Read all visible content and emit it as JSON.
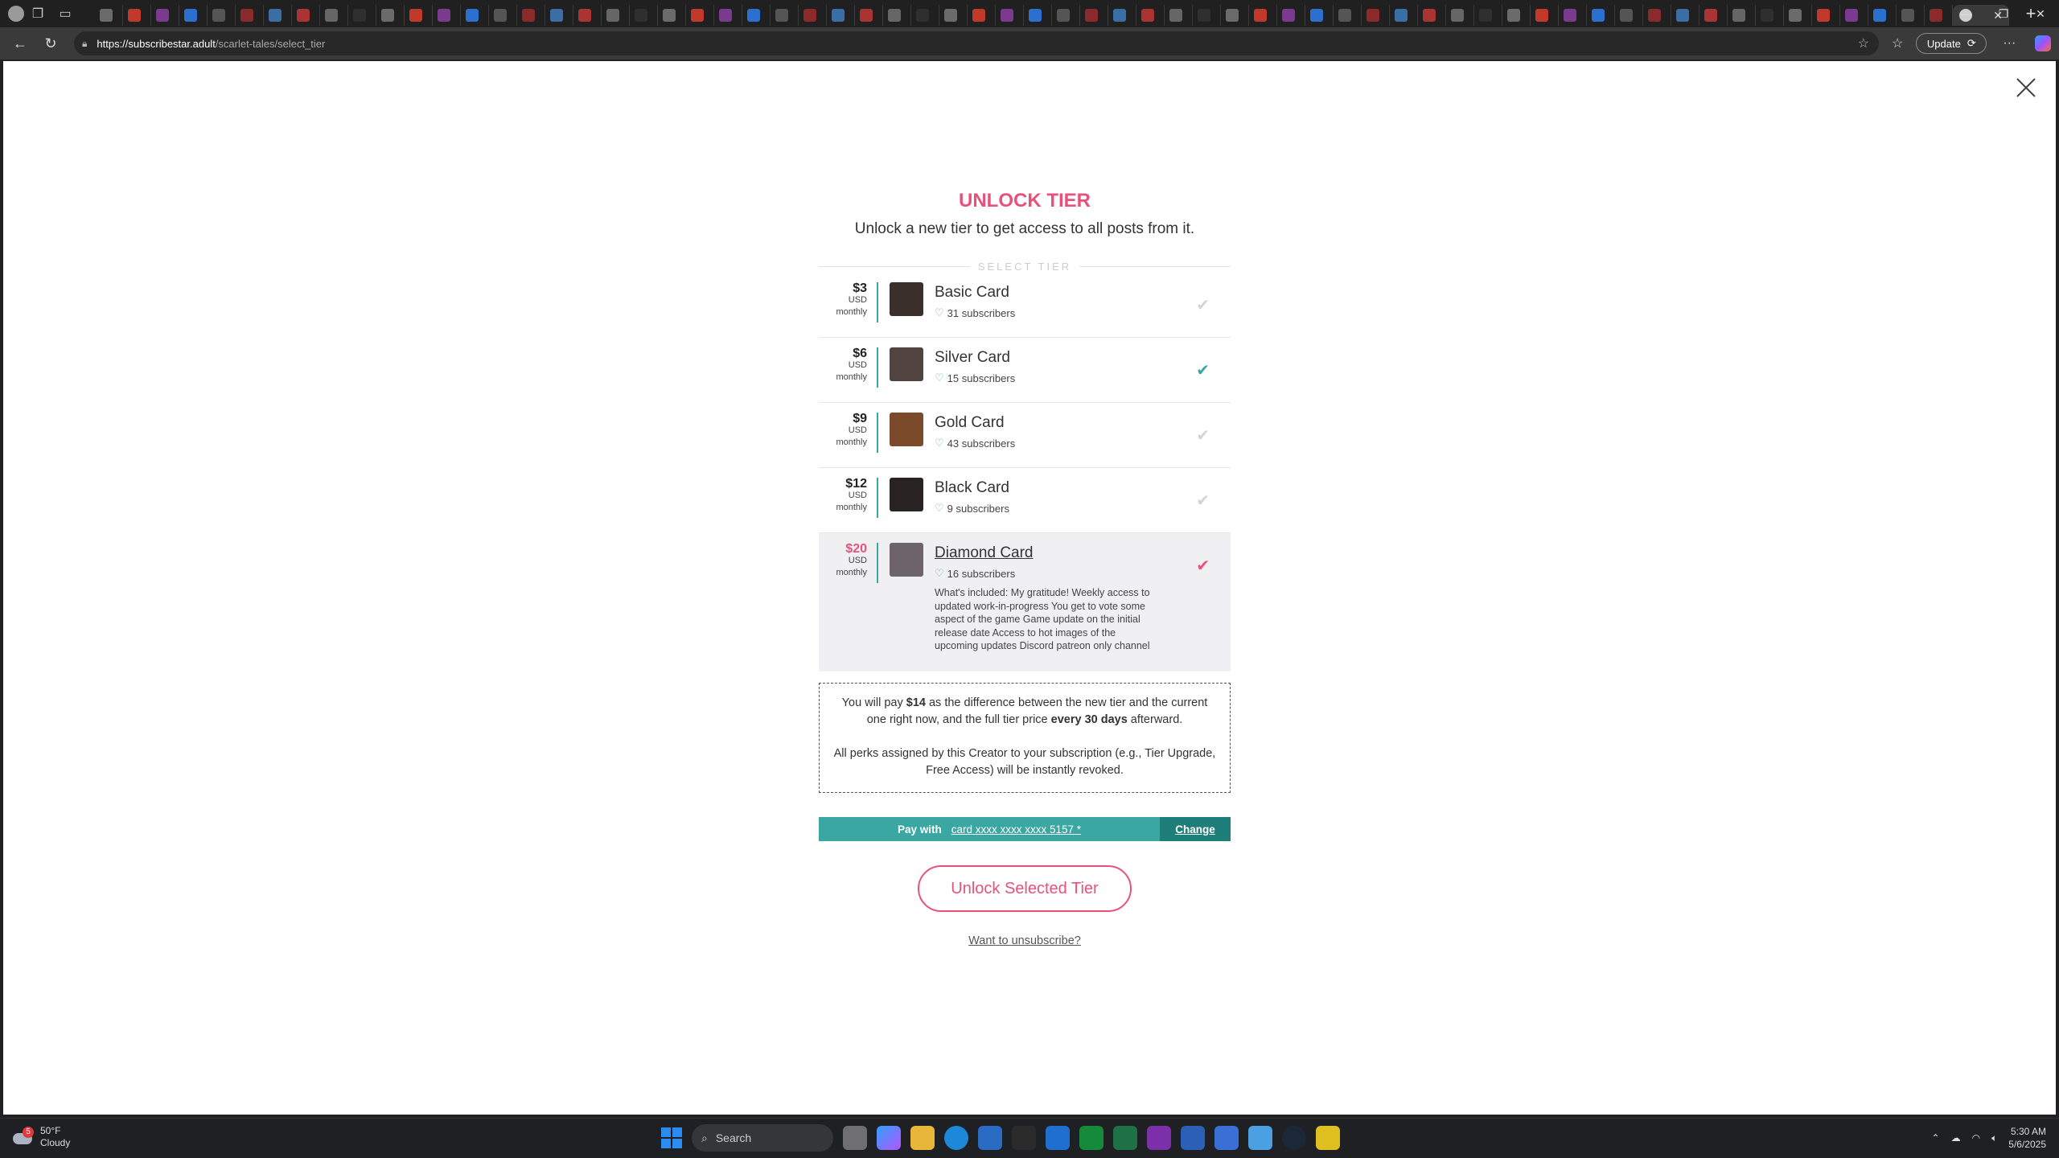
{
  "browser": {
    "url_domain": "https://subscribestar.adult",
    "url_path": "/scarlet-tales/select_tier",
    "update_label": "Update",
    "new_tab": "+",
    "tab_count": 66
  },
  "modal": {
    "title": "UNLOCK TIER",
    "subtitle": "Unlock a new tier to get access to all posts from it.",
    "select_label": "SELECT TIER",
    "tiers": [
      {
        "price": "$3",
        "currency": "USD",
        "period": "monthly",
        "name": "Basic Card",
        "subscribers": "31 subscribers",
        "state": "available",
        "thumb_color": "#3b2f2c"
      },
      {
        "price": "$6",
        "currency": "USD",
        "period": "monthly",
        "name": "Silver Card",
        "subscribers": "15 subscribers",
        "state": "current",
        "thumb_color": "#514440"
      },
      {
        "price": "$9",
        "currency": "USD",
        "period": "monthly",
        "name": "Gold Card",
        "subscribers": "43 subscribers",
        "state": "available",
        "thumb_color": "#7a4a2a"
      },
      {
        "price": "$12",
        "currency": "USD",
        "period": "monthly",
        "name": "Black Card",
        "subscribers": "9 subscribers",
        "state": "available",
        "thumb_color": "#2a2324"
      },
      {
        "price": "$20",
        "currency": "USD",
        "period": "monthly",
        "name": "Diamond Card",
        "subscribers": "16 subscribers",
        "state": "selected",
        "thumb_color": "#6c6468",
        "description": "What's included: My gratitude! Weekly access to updated work-in-progress You get to vote some aspect of the game Game update on the initial release date Access to hot images of the upcoming updates Discord patreon only channel"
      }
    ],
    "notice": {
      "p1_pre": "You will pay ",
      "p1_amount": "$14",
      "p1_mid": " as the difference between the new tier and the current one right now, and the full tier price ",
      "p1_period": "every 30 days",
      "p1_post": " afterward.",
      "p2": "All perks assigned by this Creator to your subscription (e.g., Tier Upgrade, Free Access) will be instantly revoked."
    },
    "pay": {
      "label": "Pay with",
      "card": "card  xxxx xxxx xxxx 5157 *",
      "change": "Change"
    },
    "unlock_button": "Unlock Selected Tier",
    "unsubscribe_link": "Want to unsubscribe?",
    "accent_color": "#e8517a",
    "teal_color": "#3aa7a3"
  },
  "taskbar": {
    "weather_temp": "50°F",
    "weather_desc": "Cloudy",
    "weather_badge": "5",
    "search_placeholder": "Search",
    "time": "5:30 AM",
    "date": "5/6/2025"
  }
}
